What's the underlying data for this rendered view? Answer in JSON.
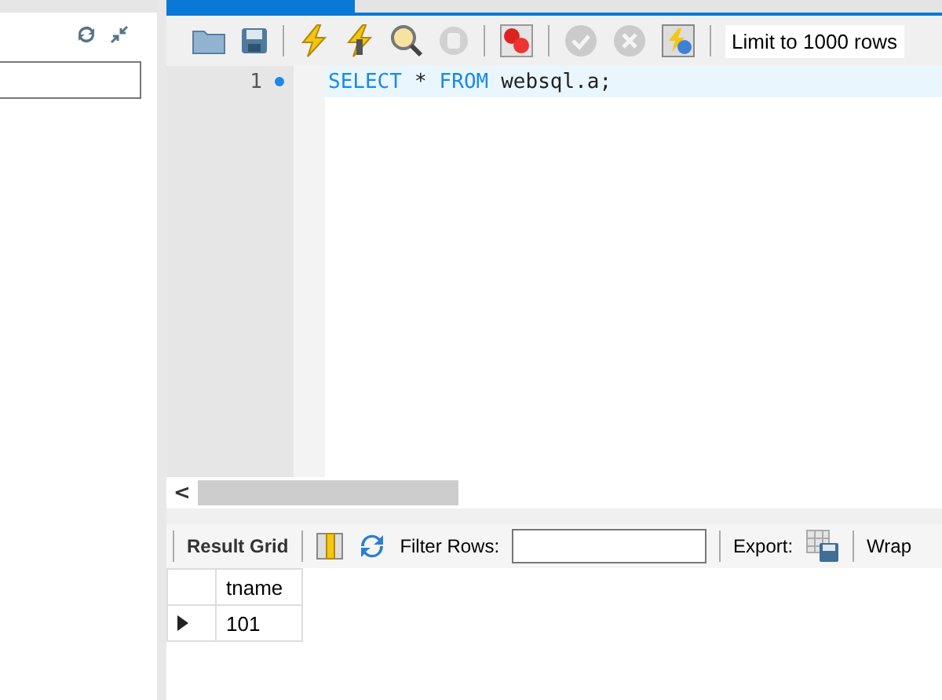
{
  "toolbar": {
    "buttons": [
      {
        "kind": "folder",
        "disabled": false
      },
      {
        "kind": "save",
        "disabled": false
      },
      {
        "kind": "separator"
      },
      {
        "kind": "bolt",
        "disabled": false
      },
      {
        "kind": "bolt-cursor",
        "disabled": false
      },
      {
        "kind": "magnifier",
        "disabled": false
      },
      {
        "kind": "stop",
        "disabled": true
      },
      {
        "kind": "separator"
      },
      {
        "kind": "error-toggle",
        "disabled": false
      },
      {
        "kind": "separator"
      },
      {
        "kind": "commit",
        "disabled": true
      },
      {
        "kind": "rollback",
        "disabled": true
      },
      {
        "kind": "autocommit",
        "disabled": false
      },
      {
        "kind": "separator"
      }
    ],
    "limit": "Limit to 1000 rows"
  },
  "editor": {
    "scroll_left": "<",
    "lines": [
      {
        "number": "1",
        "marker": true,
        "current": true,
        "tokens": [
          {
            "text": "SELECT",
            "kind": "keyword"
          },
          {
            "text": "*",
            "kind": "plain"
          },
          {
            "text": "FROM",
            "kind": "keyword"
          },
          {
            "text": "websql.a;",
            "kind": "plain"
          }
        ]
      }
    ]
  },
  "result_toolbar": {
    "result_grid": "Result Grid",
    "filter_label": "Filter Rows:",
    "export_label": "Export:",
    "wrap_label": "Wrap"
  },
  "grid": {
    "columns": [
      "tname"
    ],
    "rows": [
      {
        "cells": [
          "101"
        ],
        "selected": true
      }
    ]
  }
}
